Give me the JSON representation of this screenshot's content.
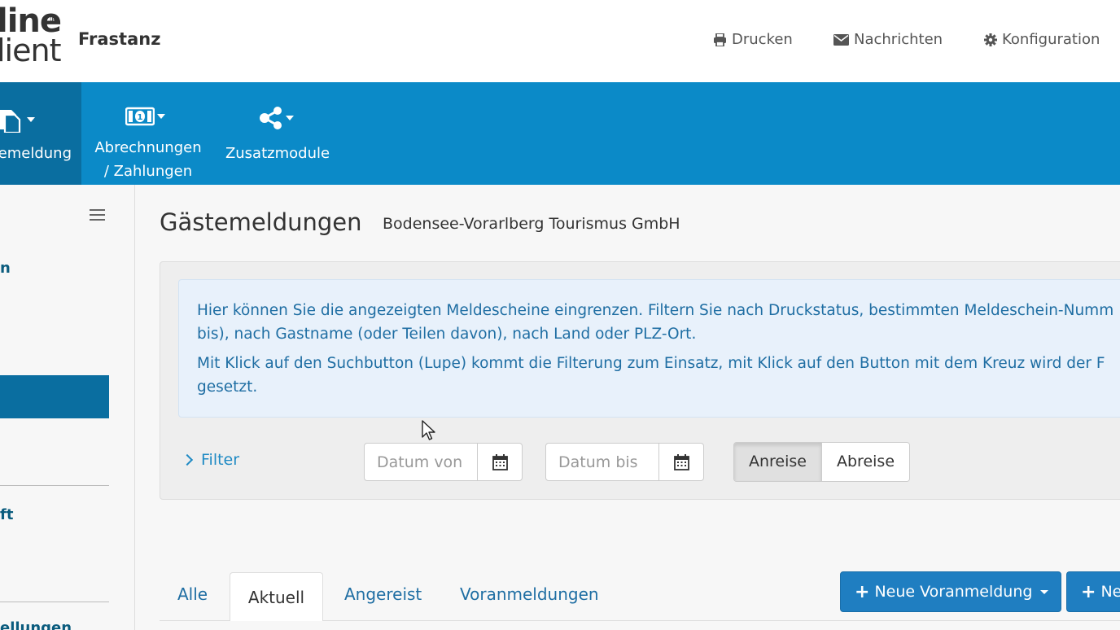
{
  "header": {
    "logo_line1": "line",
    "logo_line2": "lient",
    "logo_reg": "®",
    "org_name": "Frastanz",
    "nav": [
      {
        "label": "Drucken",
        "icon": "print-icon"
      },
      {
        "label": "Nachrichten",
        "icon": "envelope-icon"
      },
      {
        "label": "Konfiguration",
        "icon": "gear-icon"
      }
    ]
  },
  "toolbar": {
    "items": [
      {
        "label": "emeldung",
        "icon": "documents-icon",
        "active": true
      },
      {
        "label_line1": "Abrechnungen",
        "label_line2": "/ Zahlungen",
        "icon": "money-icon"
      },
      {
        "label": "Zusatzmodule",
        "icon": "share-icon"
      }
    ]
  },
  "sidebar": {
    "fragments": [
      "n",
      "ft",
      "ellungen"
    ]
  },
  "main": {
    "title": "Gästemeldungen",
    "subtitle": "Bodensee-Vorarlberg Tourismus GmbH",
    "info": {
      "para1_line1": "Hier können Sie die angezeigten Meldescheine eingrenzen. Filtern Sie nach Druckstatus, bestimmten Meldeschein-Numm",
      "para1_line2": "bis), nach Gastname (oder Teilen davon), nach Land oder PLZ-Ort.",
      "para2_line1": "Mit Klick auf den Suchbutton (Lupe) kommt die Filterung zum Einsatz, mit Klick auf den Button mit dem Kreuz wird der F",
      "para2_line2": "gesetzt."
    },
    "filter": {
      "label": "Filter",
      "date_from_placeholder": "Datum von",
      "date_to_placeholder": "Datum bis",
      "toggle_arrival": "Anreise",
      "toggle_departure": "Abreise",
      "selected": "Anreise"
    },
    "tabs": [
      {
        "label": "Alle"
      },
      {
        "label": "Aktuell",
        "active": true
      },
      {
        "label": "Angereist"
      },
      {
        "label": "Voranmeldungen"
      }
    ],
    "buttons": {
      "new_prereg": "Neue Voranmeldung",
      "new_cut": "Ne"
    }
  }
}
